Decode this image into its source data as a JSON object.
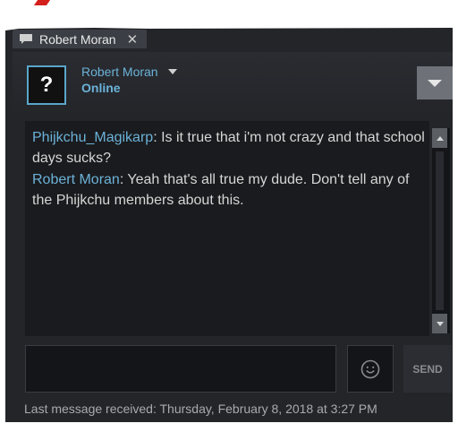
{
  "tab": {
    "title": "Robert Moran",
    "close_label": "✕",
    "icon": "chat-bubble-icon"
  },
  "friend": {
    "name": "Robert Moran",
    "status": "Online",
    "avatar_text": "?"
  },
  "messages": [
    {
      "sender": "Phijkchu_Magikarp",
      "text": ": Is it true that i'm not crazy and that school days sucks?"
    },
    {
      "sender": "Robert Moran",
      "text": ": Yeah that's all true my dude. Don't tell any of the Phijkchu members about this."
    }
  ],
  "composer": {
    "value": "",
    "send_label": "SEND",
    "emoji_icon": "smiley-icon"
  },
  "footer": {
    "last_message": "Last message received: Thursday, February 8, 2018 at 3:27 PM"
  },
  "colors": {
    "accent": "#6bb2d8",
    "background": "#232529",
    "text": "#d6d6d6"
  }
}
